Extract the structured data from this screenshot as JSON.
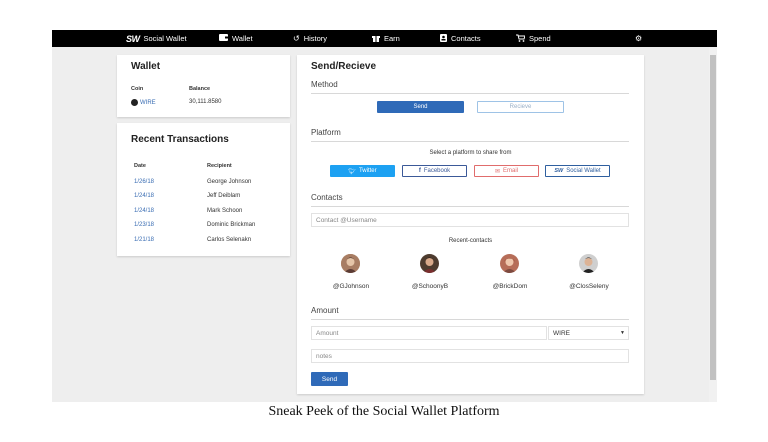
{
  "nav": {
    "brand_logo": "SW",
    "brand_name": "Social Wallet",
    "items": [
      {
        "label": "Wallet",
        "icon": "wallet-icon"
      },
      {
        "label": "History",
        "icon": "history-icon"
      },
      {
        "label": "Earn",
        "icon": "gift-icon"
      },
      {
        "label": "Contacts",
        "icon": "address-book-icon"
      },
      {
        "label": "Spend",
        "icon": "cart-icon"
      }
    ],
    "settings_icon": "gear-icon"
  },
  "wallet": {
    "title": "Wallet",
    "coin_header": "Coin",
    "balance_header": "Balance",
    "coin": "WIRE",
    "balance": "30,111.8580"
  },
  "transactions": {
    "title": "Recent Transactions",
    "date_header": "Date",
    "recipient_header": "Recipient",
    "rows": [
      {
        "date": "1/26/18",
        "recipient": "George Johnson"
      },
      {
        "date": "1/24/18",
        "recipient": "Jeff Deiblam"
      },
      {
        "date": "1/24/18",
        "recipient": "Mark Schoon"
      },
      {
        "date": "1/23/18",
        "recipient": "Dominic Brickman"
      },
      {
        "date": "1/21/18",
        "recipient": "Carlos Selenakn"
      }
    ]
  },
  "send": {
    "title": "Send/Recieve",
    "method_title": "Method",
    "send_button": "Send",
    "recieve_button": "Recieve",
    "platform_title": "Platform",
    "platform_prompt": "Select a platform to share from",
    "platforms": [
      {
        "label": "Twitter",
        "icon": "twitter-icon",
        "color": "#1da1f2"
      },
      {
        "label": "Facebook",
        "icon": "facebook-icon",
        "color": "#3b5998"
      },
      {
        "label": "Email",
        "icon": "envelope-icon",
        "color": "#e06c6c"
      },
      {
        "label": "Social Wallet",
        "icon": "social-wallet-icon",
        "color": "#2f5f9f"
      }
    ],
    "contacts_title": "Contacts",
    "contact_placeholder": "Contact @Username",
    "recent_contacts_label": "Recent-contacts",
    "recent_contacts": [
      "@GJohnson",
      "@SchoonyB",
      "@BrickDom",
      "@ClosSeleny"
    ],
    "amount_title": "Amount",
    "amount_placeholder": "Amount",
    "currency": "WIRE",
    "notes_placeholder": "notes",
    "submit_button": "Send"
  },
  "colors": {
    "primary": "#2f6ab8",
    "navbar": "#000000",
    "background": "#eeeeee"
  },
  "caption": "Sneak Peek of the Social Wallet Platform"
}
